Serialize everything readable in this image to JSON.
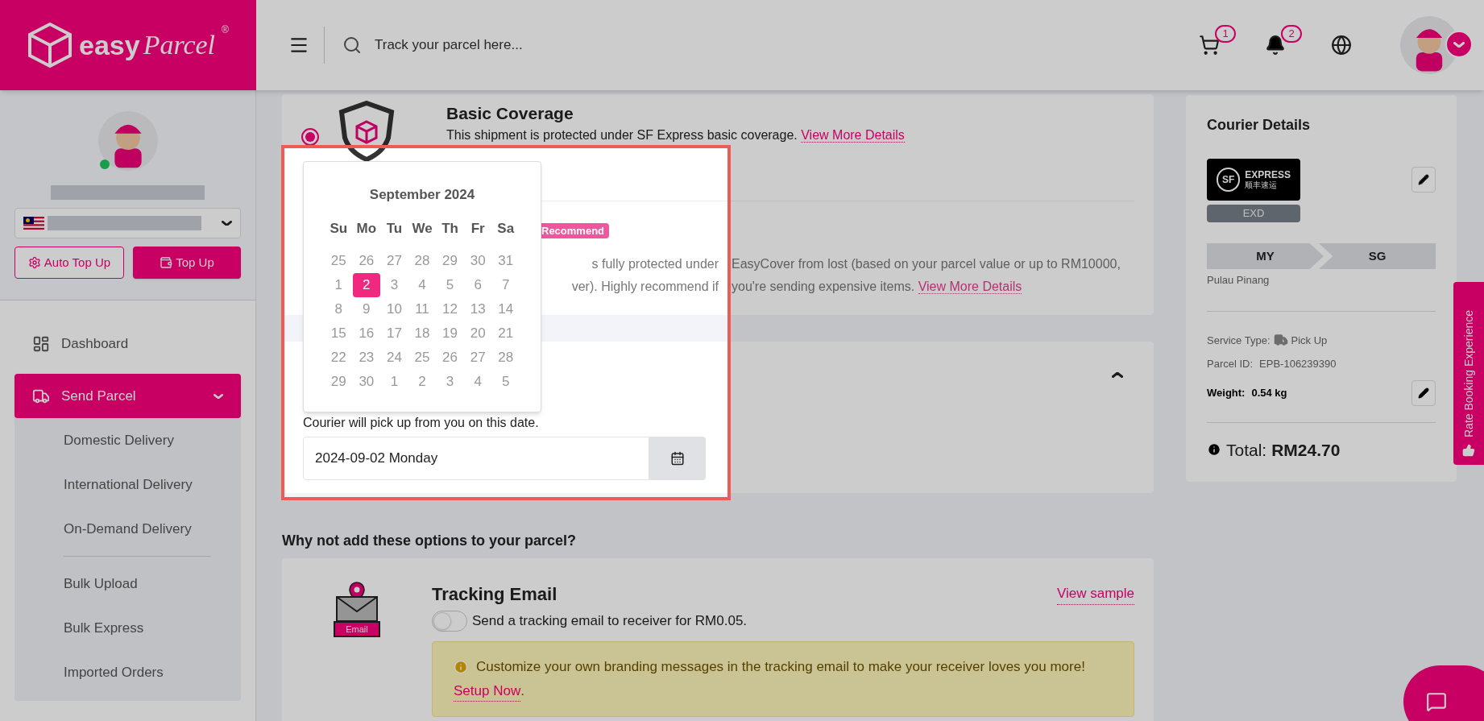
{
  "header": {
    "logo": {
      "first": "easy",
      "second": "Parcel",
      "mark": "®"
    },
    "search": {
      "placeholder": "Track your parcel here..."
    },
    "cart_count": "1",
    "notification_count": "2"
  },
  "sidebar": {
    "buttons": [
      {
        "kind": "outline",
        "label": "Auto Top Up"
      },
      {
        "kind": "filled",
        "label": "Top Up"
      }
    ],
    "menu": [
      {
        "kind": "dashboard",
        "label": "Dashboard",
        "selected": false
      },
      {
        "kind": "truck",
        "label": "Send Parcel",
        "selected": true,
        "expanded": true,
        "groups": [
          [
            "Domestic Delivery",
            "International Delivery",
            "On-Demand Delivery"
          ],
          [
            "Bulk Upload",
            "Bulk Express",
            "Imported Orders"
          ]
        ]
      }
    ]
  },
  "coverage": {
    "basic": {
      "selected": true,
      "title": "Basic Coverage",
      "text": "This shipment is protected under SF Express basic coverage.",
      "link": "View More Details"
    },
    "easycover": {
      "badge": "Recommend",
      "line_1": "s fully protected under EasyCover from lost (based on your parcel value or up to RM10000,",
      "line_2": "ver). Highly recommend if you're sending expensive items.",
      "link": "View More Details"
    }
  },
  "pickup": {
    "expanded": true,
    "note": "Courier will pick up from you on this date.",
    "value": "2024-09-02 Monday"
  },
  "calendar": {
    "title": "September 2024",
    "weekdays": [
      "Su",
      "Mo",
      "Tu",
      "We",
      "Th",
      "Fr",
      "Sa"
    ],
    "weeks": [
      [
        {
          "day": "25",
          "selected": false
        },
        {
          "day": "26",
          "selected": false
        },
        {
          "day": "27",
          "selected": false
        },
        {
          "day": "28",
          "selected": false
        },
        {
          "day": "29",
          "selected": false
        },
        {
          "day": "30",
          "selected": false
        },
        {
          "day": "31",
          "selected": false
        }
      ],
      [
        {
          "day": "1",
          "selected": false
        },
        {
          "day": "2",
          "selected": true
        },
        {
          "day": "3",
          "selected": false
        },
        {
          "day": "4",
          "selected": false
        },
        {
          "day": "5",
          "selected": false
        },
        {
          "day": "6",
          "selected": false
        },
        {
          "day": "7",
          "selected": false
        }
      ],
      [
        {
          "day": "8",
          "selected": false
        },
        {
          "day": "9",
          "selected": false
        },
        {
          "day": "10",
          "selected": false
        },
        {
          "day": "11",
          "selected": false
        },
        {
          "day": "12",
          "selected": false
        },
        {
          "day": "13",
          "selected": false
        },
        {
          "day": "14",
          "selected": false
        }
      ],
      [
        {
          "day": "15",
          "selected": false
        },
        {
          "day": "16",
          "selected": false
        },
        {
          "day": "17",
          "selected": false
        },
        {
          "day": "18",
          "selected": false
        },
        {
          "day": "19",
          "selected": false
        },
        {
          "day": "20",
          "selected": false
        },
        {
          "day": "21",
          "selected": false
        }
      ],
      [
        {
          "day": "22",
          "selected": false
        },
        {
          "day": "23",
          "selected": false
        },
        {
          "day": "24",
          "selected": false
        },
        {
          "day": "25",
          "selected": false
        },
        {
          "day": "26",
          "selected": false
        },
        {
          "day": "27",
          "selected": false
        },
        {
          "day": "28",
          "selected": false
        }
      ],
      [
        {
          "day": "29",
          "selected": false
        },
        {
          "day": "30",
          "selected": false
        },
        {
          "day": "1",
          "selected": false
        },
        {
          "day": "2",
          "selected": false
        },
        {
          "day": "3",
          "selected": false
        },
        {
          "day": "4",
          "selected": false
        },
        {
          "day": "5",
          "selected": false
        }
      ]
    ]
  },
  "courier": {
    "title": "Courier Details",
    "logo": {
      "mark": "SF",
      "name": "EXPRESS",
      "name_local": "顺丰速运"
    },
    "service": "EXD",
    "from": "MY",
    "to": "SG",
    "origin": "Pulau Pinang",
    "service_type": {
      "label": "Service Type:",
      "value": "Pick Up"
    },
    "parcel_id": {
      "label": "Parcel ID:",
      "value": "EPB-106239390"
    },
    "weight": {
      "label": "Weight:",
      "value": "0.54 kg"
    },
    "total": {
      "label": "Total:",
      "value": "RM24.70"
    }
  },
  "feedback_tab": {
    "label": "Rate Booking Experience"
  },
  "addons": {
    "heading": "Why not add these options to your parcel?",
    "items": [
      {
        "title": "Tracking Email",
        "link": "View sample",
        "icon_label": "Email",
        "on": false,
        "label": "Send a tracking email to receiver for RM0.05.",
        "tip": "Customize your own branding messages in the tracking email to make your receiver loves you more!",
        "tip_link": "Setup Now",
        "tip_end": "."
      }
    ]
  }
}
